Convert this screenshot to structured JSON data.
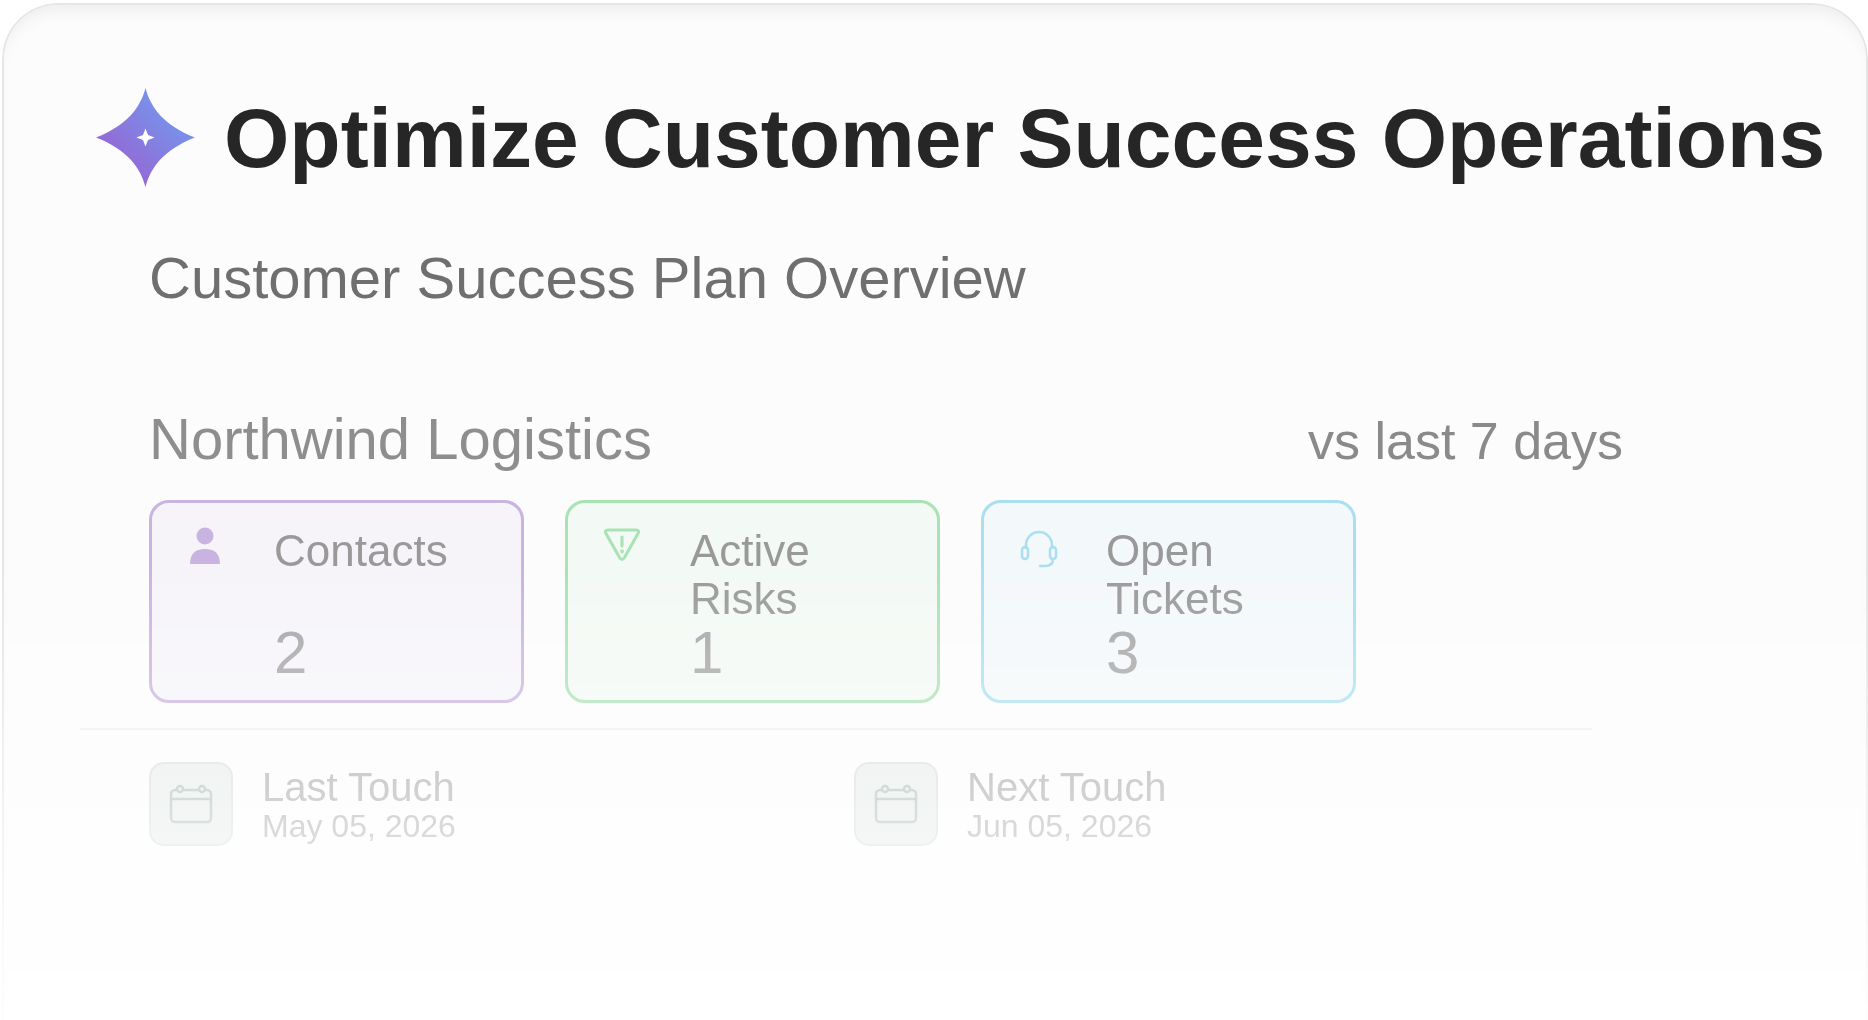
{
  "title": "Optimize Customer Success Operations",
  "subtitle": "Customer Success Plan Overview",
  "account": {
    "name": "Northwind Logistics",
    "comparison": "vs last 7 days"
  },
  "stats": [
    {
      "kind": "contacts",
      "label": "Contacts",
      "value": "2",
      "color": "#c9b3e0"
    },
    {
      "kind": "risks",
      "label": "Active Risks",
      "value": "1",
      "color": "#a9e2b3"
    },
    {
      "kind": "tickets",
      "label": "Open Tickets",
      "value": "3",
      "color": "#a9dff0"
    }
  ],
  "touchpoints": [
    {
      "label": "Last Touch",
      "date": "May 05, 2026"
    },
    {
      "label": "Next Touch",
      "date": "Jun 05, 2026"
    }
  ]
}
